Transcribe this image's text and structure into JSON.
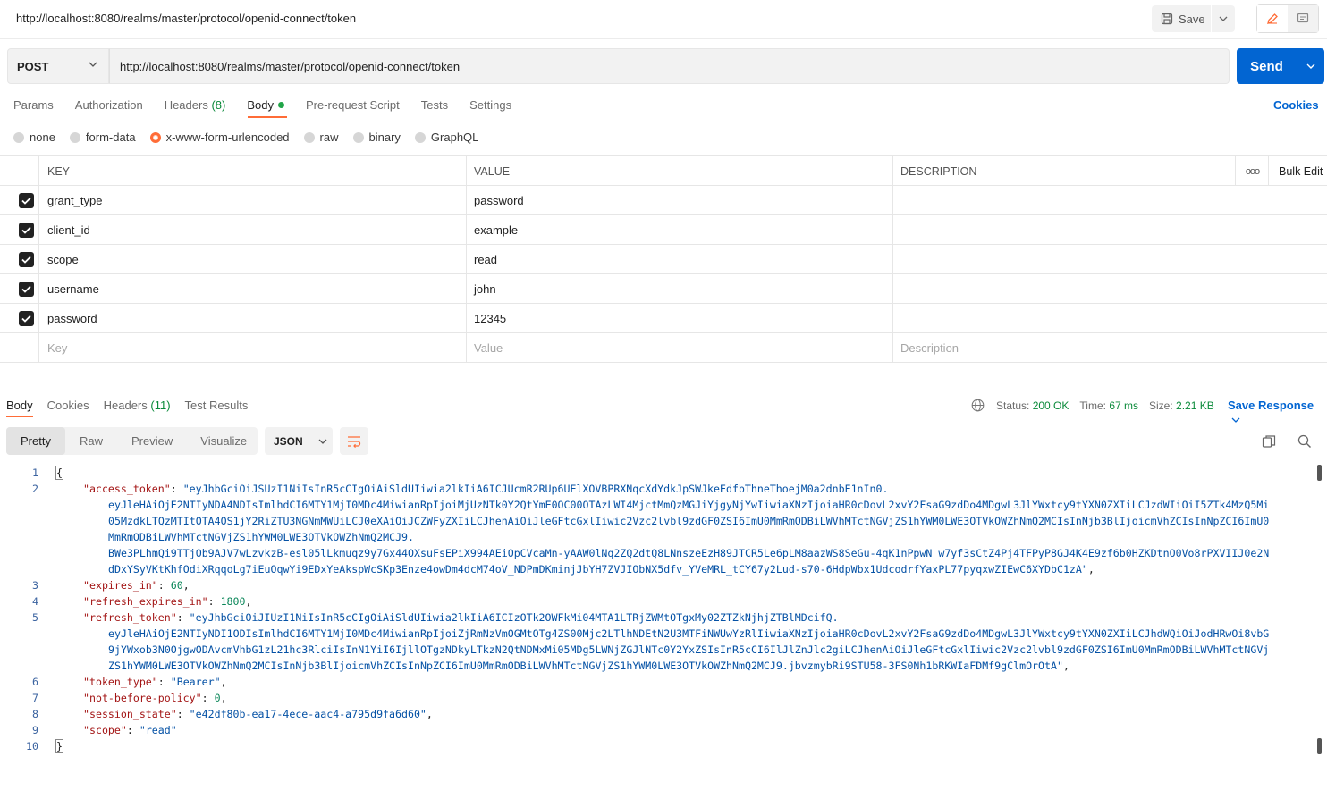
{
  "window": {
    "title": "http://localhost:8080/realms/master/protocol/openid-connect/token",
    "save_label": "Save"
  },
  "request": {
    "method": "POST",
    "url": "http://localhost:8080/realms/master/protocol/openid-connect/token",
    "send_label": "Send",
    "tabs": [
      {
        "label": "Params"
      },
      {
        "label": "Authorization"
      },
      {
        "label": "Headers",
        "count": "(8)"
      },
      {
        "label": "Body"
      },
      {
        "label": "Pre-request Script"
      },
      {
        "label": "Tests"
      },
      {
        "label": "Settings"
      }
    ],
    "active_tab": "Body",
    "cookies_label": "Cookies",
    "body_types": [
      "none",
      "form-data",
      "x-www-form-urlencoded",
      "raw",
      "binary",
      "GraphQL"
    ],
    "selected_body_type": "x-www-form-urlencoded"
  },
  "params": {
    "headers": {
      "key": "KEY",
      "value": "VALUE",
      "description": "DESCRIPTION",
      "more": "ooo",
      "bulk_edit": "Bulk Edit"
    },
    "rows": [
      {
        "key": "grant_type",
        "value": "password",
        "checked": true
      },
      {
        "key": "client_id",
        "value": "example",
        "checked": true
      },
      {
        "key": "scope",
        "value": "read",
        "checked": true
      },
      {
        "key": "username",
        "value": "john",
        "checked": true
      },
      {
        "key": "password",
        "value": "12345",
        "checked": true
      }
    ],
    "placeholders": {
      "key": "Key",
      "value": "Value",
      "description": "Description"
    }
  },
  "response": {
    "tabs": [
      {
        "label": "Body"
      },
      {
        "label": "Cookies"
      },
      {
        "label": "Headers",
        "count": "(11)"
      },
      {
        "label": "Test Results"
      }
    ],
    "status_label": "Status:",
    "status_value": "200 OK",
    "time_label": "Time:",
    "time_value": "67 ms",
    "size_label": "Size:",
    "size_value": "2.21 KB",
    "save_response_label": "Save Response",
    "view_tabs": [
      "Pretty",
      "Raw",
      "Preview",
      "Visualize"
    ],
    "active_view": "Pretty",
    "format": "JSON",
    "line_numbers": [
      "1",
      "2",
      "3",
      "4",
      "5",
      "6",
      "7",
      "8",
      "9",
      "10"
    ],
    "json": {
      "access_token_key": "\"access_token\"",
      "access_token_lines": [
        "\"eyJhbGciOiJSUzI1NiIsInR5cCIgOiAiSldUIiwia2lkIiA6ICJUcmR2RUp6UElXOVBPRXNqcXdYdkJpSWJkeEdfbThneThoejM0a2dnbE1nIn0.",
        "eyJleHAiOjE2NTIyNDA4NDIsImlhdCI6MTY1MjI0MDc4MiwianRpIjoiMjUzNTk0Y2QtYmE0OC00OTAzLWI4MjctMmQzMGJiYjgyNjYwIiwiaXNzIjoiaHR0cDovL2xvY2FsaG9zdDo4MDgwL3JlYWxtcy9tYXN0ZXIiLCJzdWIiOiI5ZTk4MzQ5Mi",
        "05MzdkLTQzMTItOTA4OS1jY2RiZTU3NGNmMWUiLCJ0eXAiOiJCZWFyZXIiLCJhenAiOiJleGFtcGxlIiwic2Vzc2lvbl9zdGF0ZSI6ImU0MmRmODBiLWVhMTctNGVjZS1hYWM0LWE3OTVkOWZhNmQ2MCIsInNjb3BlIjoicmVhZCIsInNpZCI6ImU0",
        "MmRmODBiLWVhMTctNGVjZS1hYWM0LWE3OTVkOWZhNmQ2MCJ9.",
        "BWe3PLhmQi9TTjOb9AJV7wLzvkzB-esl05lLkmuqz9y7Gx44OXsuFsEPiX994AEiOpCVcaMn-yAAW0lNq2ZQ2dtQ8LNnszeEzH89JTCR5Le6pLM8aazWS8SeGu-4qK1nPpwN_w7yf3sCtZ4Pj4TFPyP8GJ4K4E9zf6b0HZKDtnO0Vo8rPXVIIJ0e2N",
        "dDxYSyVKtKhfOdiXRqqoLg7iEuOqwYi9EDxYeAkspWcSKp3Enze4owDm4dcM74oV_NDPmDKminjJbYH7ZVJIObNX5dfv_YVeMRL_tCY67y2Lud-s70-6HdpWbx1UdcodrfYaxPL77pyqxwZIEwC6XYDbC1zA\""
      ],
      "expires_in_key": "\"expires_in\"",
      "expires_in": "60",
      "refresh_expires_in_key": "\"refresh_expires_in\"",
      "refresh_expires_in": "1800",
      "refresh_token_key": "\"refresh_token\"",
      "refresh_token_lines": [
        "\"eyJhbGciOiJIUzI1NiIsInR5cCIgOiAiSldUIiwia2lkIiA6ICIzOTk2OWFkMi04MTA1LTRjZWMtOTgxMy02ZTZkNjhjZTBlMDcifQ.",
        "eyJleHAiOjE2NTIyNDI1ODIsImlhdCI6MTY1MjI0MDc4MiwianRpIjoiZjRmNzVmOGMtOTg4ZS00Mjc2LTlhNDEtN2U3MTFiNWUwYzRlIiwiaXNzIjoiaHR0cDovL2xvY2FsaG9zdDo4MDgwL3JlYWxtcy9tYXN0ZXIiLCJhdWQiOiJodHRwOi8vbG",
        "9jYWxob3N0OjgwODAvcmVhbG1zL21hc3RlciIsInN1YiI6IjllOTgzNDkyLTkzN2QtNDMxMi05MDg5LWNjZGJlNTc0Y2YxZSIsInR5cCI6IlJlZnJlc2giLCJhenAiOiJleGFtcGxlIiwic2Vzc2lvbl9zdGF0ZSI6ImU0MmRmODBiLWVhMTctNGVj",
        "ZS1hYWM0LWE3OTVkOWZhNmQ2MCIsInNjb3BlIjoicmVhZCIsInNpZCI6ImU0MmRmODBiLWVhMTctNGVjZS1hYWM0LWE3OTVkOWZhNmQ2MCJ9.jbvzmybRi9STU58-3FS0Nh1bRKWIaFDMf9gClmOrOtA\""
      ],
      "token_type_key": "\"token_type\"",
      "token_type": "\"Bearer\"",
      "not_before_policy_key": "\"not-before-policy\"",
      "not_before_policy": "0",
      "session_state_key": "\"session_state\"",
      "session_state": "\"e42df80b-ea17-4ece-aac4-a795d9fa6d60\"",
      "scope_key": "\"scope\"",
      "scope": "\"read\""
    }
  },
  "colors": {
    "accent_orange": "#ff6c37",
    "send_blue": "#0265d2",
    "status_green": "#0a8a3a"
  }
}
